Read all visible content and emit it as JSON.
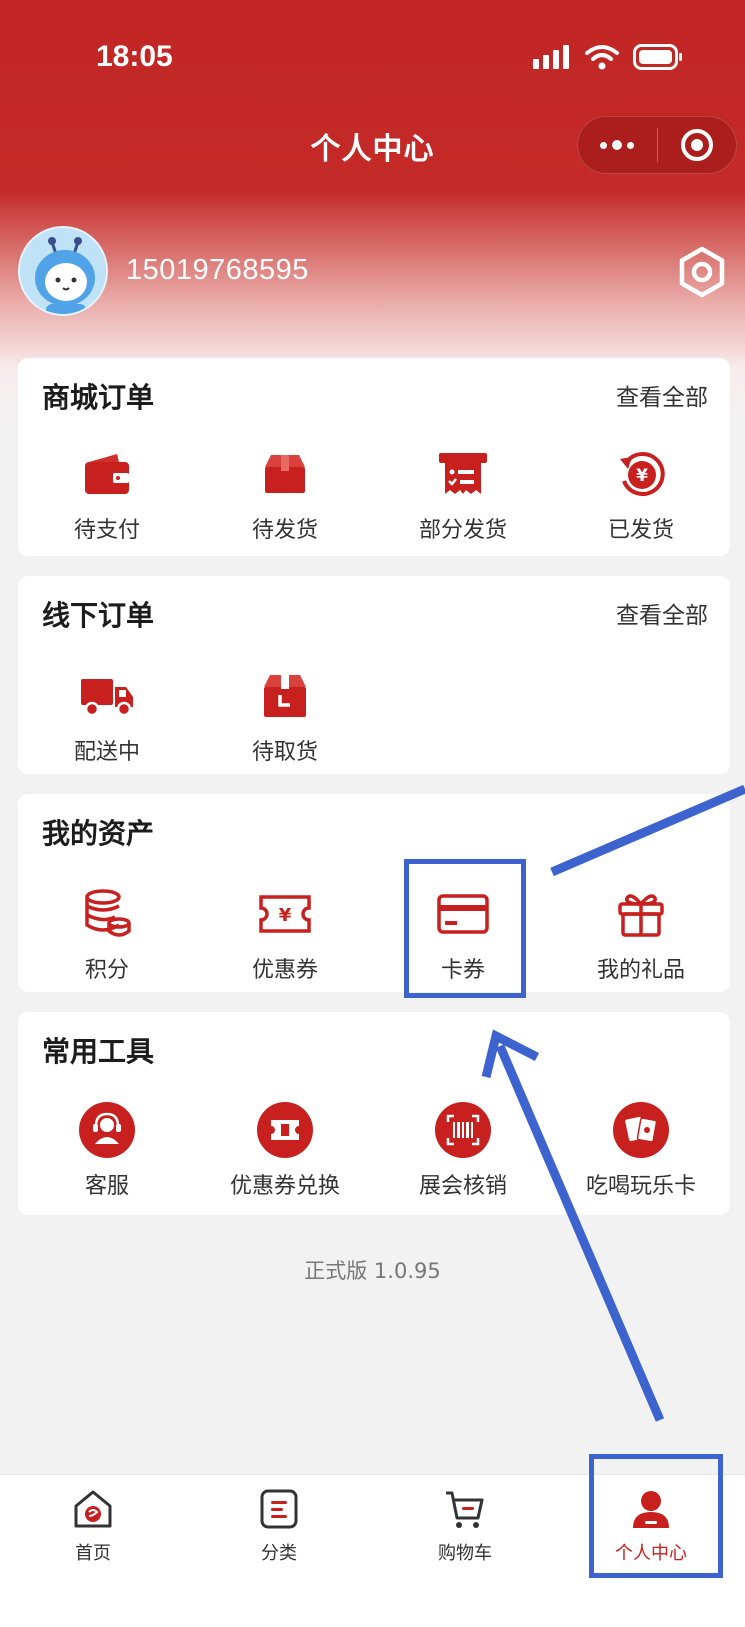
{
  "status_bar": {
    "time": "18:05"
  },
  "nav": {
    "title": "个人中心"
  },
  "profile": {
    "phone": "15019768595"
  },
  "mall_orders": {
    "title": "商城订单",
    "view_all": "查看全部",
    "items": [
      {
        "label": "待支付",
        "icon": "wallet-icon"
      },
      {
        "label": "待发货",
        "icon": "box-icon"
      },
      {
        "label": "部分发货",
        "icon": "receipt-icon"
      },
      {
        "label": "已发货",
        "icon": "yen-refresh-icon"
      }
    ]
  },
  "offline_orders": {
    "title": "线下订单",
    "view_all": "查看全部",
    "items": [
      {
        "label": "配送中",
        "icon": "truck-icon"
      },
      {
        "label": "待取货",
        "icon": "package-clock-icon"
      }
    ]
  },
  "assets": {
    "title": "我的资产",
    "items": [
      {
        "label": "积分",
        "icon": "coins-icon"
      },
      {
        "label": "优惠券",
        "icon": "ticket-yen-icon"
      },
      {
        "label": "卡券",
        "icon": "card-icon"
      },
      {
        "label": "我的礼品",
        "icon": "gift-icon"
      }
    ]
  },
  "tools": {
    "title": "常用工具",
    "items": [
      {
        "label": "客服",
        "icon": "headset-icon"
      },
      {
        "label": "优惠券兑换",
        "icon": "coupon-exchange-icon"
      },
      {
        "label": "展会核销",
        "icon": "barcode-scan-icon"
      },
      {
        "label": "吃喝玩乐卡",
        "icon": "cards-icon"
      }
    ]
  },
  "footer": {
    "version": "正式版 1.0.95"
  },
  "tabbar": {
    "items": [
      {
        "label": "首页",
        "icon": "home-icon"
      },
      {
        "label": "分类",
        "icon": "category-icon"
      },
      {
        "label": "购物车",
        "icon": "cart-icon"
      },
      {
        "label": "个人中心",
        "icon": "user-icon"
      }
    ],
    "active_index": 3
  },
  "colors": {
    "brand_red": "#c8201e",
    "annotation_blue": "#3d63cf"
  }
}
